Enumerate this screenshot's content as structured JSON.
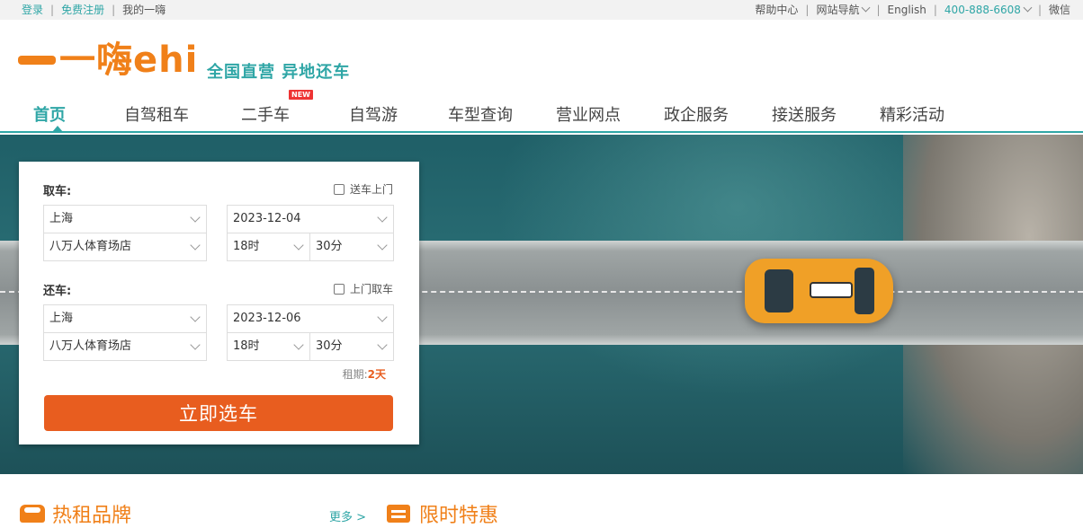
{
  "topbar": {
    "login": "登录",
    "register": "免费注册",
    "my_account": "我的一嗨",
    "help": "帮助中心",
    "site_nav": "网站导航",
    "english": "English",
    "phone": "400-888-6608",
    "wechat": "微信",
    "separator": "|"
  },
  "header": {
    "logo_text": "一嗨ehi",
    "slogan": "全国直营 异地还车"
  },
  "nav": {
    "items": [
      "首页",
      "自驾租车",
      "二手车",
      "自驾游",
      "车型查询",
      "营业网点",
      "政企服务",
      "接送服务",
      "精彩活动"
    ],
    "active_index": 0,
    "new_badge": "NEW"
  },
  "booking": {
    "pickup": {
      "label": "取车:",
      "delivery_option": "送车上门",
      "city": "上海",
      "date": "2023-12-04",
      "store": "八万人体育场店",
      "hour": "18时",
      "minute": "30分"
    },
    "return": {
      "label": "还车:",
      "pickup_option": "上门取车",
      "city": "上海",
      "date": "2023-12-06",
      "store": "八万人体育场店",
      "hour": "18时",
      "minute": "30分"
    },
    "duration_label": "租期:",
    "duration_value": "2天",
    "submit_label": "立即选车"
  },
  "sections": {
    "hot_brands": "热租品牌",
    "more": "更多 >",
    "limited_deals": "限时特惠"
  },
  "colors": {
    "accent_teal": "#2fa6a6",
    "brand_orange": "#f08019",
    "cta_orange": "#e85d1f"
  }
}
